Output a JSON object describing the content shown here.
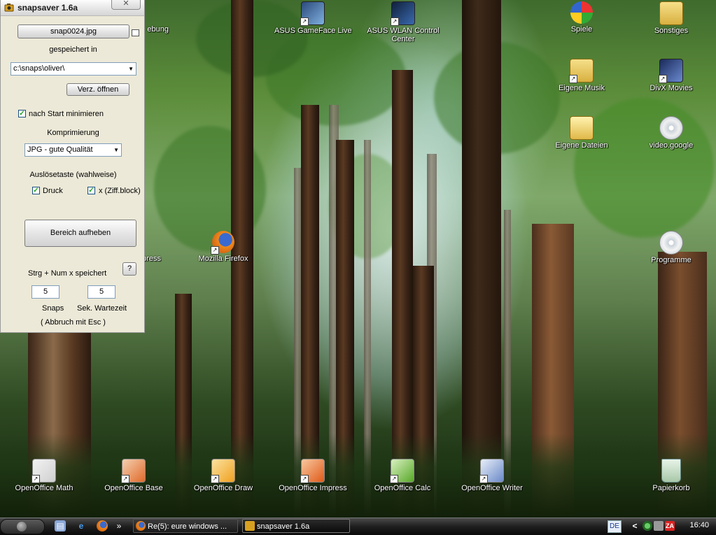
{
  "window": {
    "title": "snapsaver 1.6a",
    "close_glyph": "✕",
    "filename_button": "snap0024.jpg",
    "saved_in_label": "gespeichert in",
    "path_value": "c:\\snaps\\oliver\\",
    "open_dir_button": "Verz. öffnen",
    "minimize_on_start": {
      "label": "nach Start minimieren",
      "checked": true
    },
    "compression_label": "Komprimierung",
    "compression_value": "JPG - gute Qualität",
    "trigger_label": "Auslösetaste (wahlweise)",
    "trigger_print": {
      "label": "Druck",
      "checked": true
    },
    "trigger_numx": {
      "label": "x (Ziff.block)",
      "checked": true
    },
    "release_area_button": "Bereich aufheben",
    "hotkey_text": "Strg + Num x  speichert",
    "help_button": "?",
    "snaps_value": "5",
    "wait_value": "5",
    "snaps_label": "Snaps",
    "wait_label": "Sek. Wartezeit",
    "abort_text": "( Abbruch mit Esc )"
  },
  "desktop": {
    "icons": [
      {
        "key": "umgebung",
        "label": "ebung"
      },
      {
        "key": "asus-gameface",
        "label": "ASUS GameFace Live"
      },
      {
        "key": "asus-wlan",
        "label": "ASUS WLAN Control Center"
      },
      {
        "key": "spiele",
        "label": "Spiele"
      },
      {
        "key": "sonstiges",
        "label": "Sonstiges"
      },
      {
        "key": "eigene-musik",
        "label": "Eigene Musik"
      },
      {
        "key": "divx-movies",
        "label": "DivX Movies"
      },
      {
        "key": "eigene-dateien",
        "label": "Eigene Dateien"
      },
      {
        "key": "video-google",
        "label": "video.google"
      },
      {
        "key": "express",
        "label": "press"
      },
      {
        "key": "mozilla-firefox",
        "label": "Mozilla Firefox"
      },
      {
        "key": "programme",
        "label": "Programme"
      },
      {
        "key": "oo-math",
        "label": "OpenOffice Math"
      },
      {
        "key": "oo-base",
        "label": "OpenOffice Base"
      },
      {
        "key": "oo-draw",
        "label": "OpenOffice Draw"
      },
      {
        "key": "oo-impress",
        "label": "OpenOffice Impress"
      },
      {
        "key": "oo-calc",
        "label": "OpenOffice Calc"
      },
      {
        "key": "oo-writer",
        "label": "OpenOffice Writer"
      },
      {
        "key": "papierkorb",
        "label": "Papierkorb"
      }
    ]
  },
  "taskbar": {
    "quicklaunch_more": "»",
    "tasks": [
      {
        "label": "Re(5): eure windows ...",
        "icon": "firefox-icon"
      },
      {
        "label": "snapsaver 1.6a",
        "icon": "snapsaver-icon"
      }
    ],
    "language": "DE",
    "tray_chevron": "<",
    "clock": "16:40"
  }
}
